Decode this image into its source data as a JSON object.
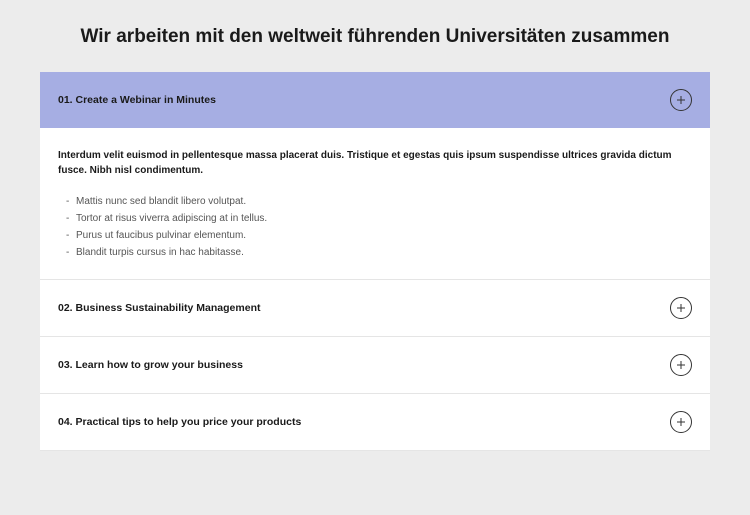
{
  "title": "Wir arbeiten mit den weltweit führenden Universitäten zusammen",
  "accordion": [
    {
      "label": "01. Create a Webinar in Minutes",
      "expanded": true,
      "intro": "Interdum velit euismod in pellentesque massa placerat duis. Tristique et egestas quis ipsum suspendisse ultrices gravida dictum fusce. Nibh nisl condimentum.",
      "bullets": [
        "Mattis nunc sed blandit libero volutpat.",
        "Tortor at risus viverra adipiscing at in tellus.",
        "Purus ut faucibus pulvinar elementum.",
        "Blandit turpis cursus in hac habitasse."
      ]
    },
    {
      "label": "02. Business Sustainability Management",
      "expanded": false
    },
    {
      "label": "03. Learn how to grow your business",
      "expanded": false
    },
    {
      "label": "04. Practical tips to help you price your products",
      "expanded": false
    }
  ]
}
